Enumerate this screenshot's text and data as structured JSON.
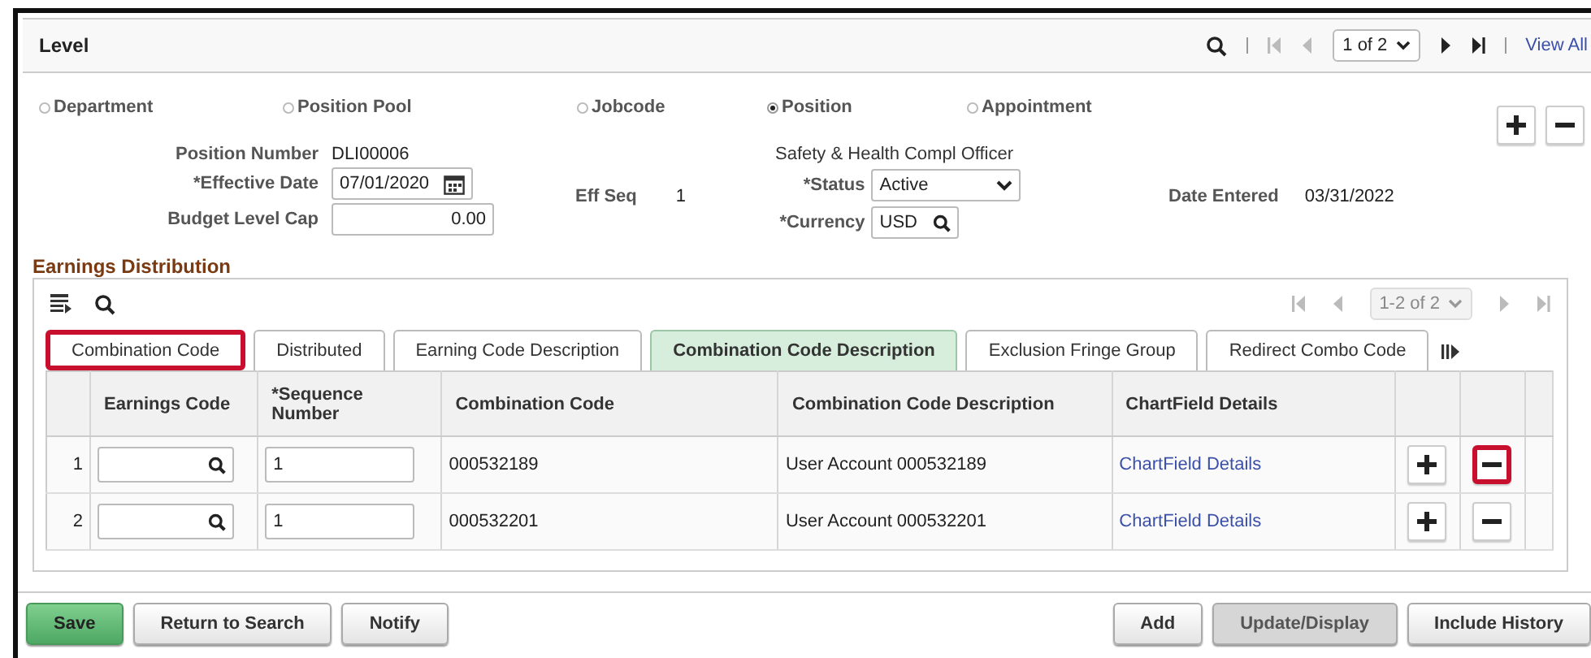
{
  "header": {
    "title": "Level",
    "pager": "1 of 2",
    "view_all": "View All"
  },
  "level_types": [
    {
      "label": "Department",
      "selected": false
    },
    {
      "label": "Position Pool",
      "selected": false
    },
    {
      "label": "Jobcode",
      "selected": false
    },
    {
      "label": "Position",
      "selected": true
    },
    {
      "label": "Appointment",
      "selected": false
    }
  ],
  "fields": {
    "position_number_label": "Position Number",
    "position_number": "DLI00006",
    "position_title": "Safety & Health Compl Officer",
    "effective_date_label": "*Effective Date",
    "effective_date": "07/01/2020",
    "eff_seq_label": "Eff Seq",
    "eff_seq": "1",
    "status_label": "*Status",
    "status": "Active",
    "date_entered_label": "Date Entered",
    "date_entered": "03/31/2022",
    "budget_cap_label": "Budget Level Cap",
    "budget_cap": "0.00",
    "currency_label": "*Currency",
    "currency": "USD"
  },
  "earnings": {
    "title": "Earnings Distribution",
    "pager": "1-2 of 2",
    "tabs": [
      {
        "label": "Combination Code",
        "selected": false,
        "highlighted": true
      },
      {
        "label": "Distributed",
        "selected": false,
        "highlighted": false
      },
      {
        "label": "Earning Code Description",
        "selected": false,
        "highlighted": false
      },
      {
        "label": "Combination Code Description",
        "selected": true,
        "highlighted": false
      },
      {
        "label": "Exclusion Fringe Group",
        "selected": false,
        "highlighted": false
      },
      {
        "label": "Redirect Combo Code",
        "selected": false,
        "highlighted": false
      }
    ],
    "columns": [
      "Earnings Code",
      "*Sequence Number",
      "Combination Code",
      "Combination Code Description",
      "ChartField Details"
    ],
    "rows": [
      {
        "number": "1",
        "sequence": "1",
        "combination_code": "000532189",
        "description": "User Account 000532189",
        "link": "ChartField Details",
        "delete_highlighted": true
      },
      {
        "number": "2",
        "sequence": "1",
        "combination_code": "000532201",
        "description": "User Account 000532201",
        "link": "ChartField Details",
        "delete_highlighted": false
      }
    ]
  },
  "buttons_left": [
    {
      "label": "Save",
      "kind": "primary"
    },
    {
      "label": "Return to Search",
      "kind": "normal"
    },
    {
      "label": "Notify",
      "kind": "normal"
    }
  ],
  "buttons_right": [
    {
      "label": "Add",
      "kind": "normal"
    },
    {
      "label": "Update/Display",
      "kind": "disabled"
    },
    {
      "label": "Include History",
      "kind": "normal"
    }
  ]
}
